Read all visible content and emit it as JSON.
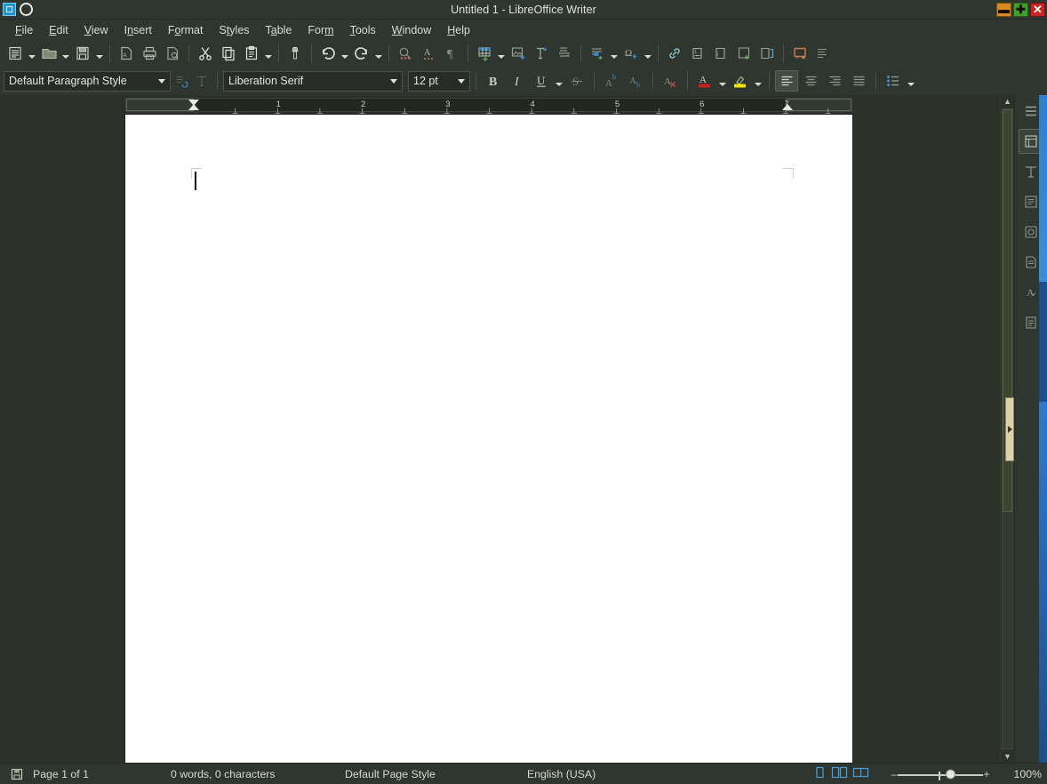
{
  "window": {
    "title": "Untitled 1 - LibreOffice Writer",
    "app_icon": "libreoffice-writer-icon",
    "controls": {
      "minimize": "–",
      "maximize": "＋",
      "close": "✕"
    }
  },
  "menubar": {
    "items": [
      {
        "label": "File",
        "pre": "F",
        "accel": "ile"
      },
      {
        "label": "Edit",
        "pre": "E",
        "accel": "dit"
      },
      {
        "label": "View",
        "pre": "V",
        "accel": "iew"
      },
      {
        "label": "Insert",
        "pre": "I",
        "accel": "nsert"
      },
      {
        "label": "Format",
        "pre": "F",
        "accel": "ormat"
      },
      {
        "label": "Styles",
        "pre": "S",
        "accel": "tyles"
      },
      {
        "label": "Table",
        "pre": "T",
        "accel": "able"
      },
      {
        "label": "Form",
        "pre": "Fo",
        "accel": "rm"
      },
      {
        "label": "Tools",
        "pre": "T",
        "accel": "ools"
      },
      {
        "label": "Window",
        "pre": "W",
        "accel": "indow"
      },
      {
        "label": "Help",
        "pre": "H",
        "accel": "elp"
      }
    ]
  },
  "standard_toolbar": {
    "buttons": [
      "new-document",
      "new-document-dropdown",
      "open-document",
      "open-document-dropdown",
      "save-document",
      "save-document-dropdown",
      "export-as-pdf",
      "print",
      "print-preview",
      "cut",
      "copy",
      "paste",
      "paste-dropdown",
      "clone-formatting",
      "undo",
      "undo-dropdown",
      "redo",
      "redo-dropdown",
      "find-and-replace",
      "spelling",
      "formatting-marks",
      "insert-table",
      "insert-table-dropdown",
      "insert-image",
      "insert-text-box",
      "insert-page-break",
      "insert-field",
      "insert-field-dropdown",
      "insert-special-character",
      "insert-special-character-dropdown",
      "insert-hyperlink",
      "insert-footnote",
      "insert-endnote",
      "insert-bookmark",
      "insert-cross-reference",
      "insert-comment",
      "track-changes"
    ]
  },
  "formatting_toolbar": {
    "paragraph_style": {
      "value": "Default Paragraph Style"
    },
    "font_name": {
      "value": "Liberation Serif"
    },
    "font_size": {
      "value": "12 pt"
    },
    "update_style": "update-selected-style",
    "new_style": "new-style-from-selection",
    "buttons": [
      "bold",
      "italic",
      "underline",
      "underline-dropdown",
      "strikethrough",
      "superscript",
      "subscript",
      "clear-direct-formatting",
      "font-color",
      "font-color-dropdown",
      "highlight-color",
      "highlight-color-dropdown",
      "align-left",
      "align-center",
      "align-right",
      "align-justified",
      "unordered-list",
      "unordered-list-dropdown"
    ],
    "font_color_swatch": "#cc2020",
    "highlight_color_swatch": "#f2e600",
    "active_button": "align-left"
  },
  "ruler": {
    "numbers": [
      "1",
      "2",
      "3",
      "4",
      "5",
      "6",
      "7"
    ],
    "tab_marker": "⊥",
    "unit": "inch"
  },
  "document": {
    "content": "",
    "cursor_visible": true
  },
  "sidebar": {
    "items": [
      {
        "name": "sidebar-settings",
        "label": "Sidebar Settings",
        "selected": false
      },
      {
        "name": "properties",
        "label": "Properties",
        "selected": true
      },
      {
        "name": "page",
        "label": "Page",
        "selected": false
      },
      {
        "name": "style-inspector",
        "label": "Style Inspector",
        "selected": false
      },
      {
        "name": "gallery",
        "label": "Gallery",
        "selected": false
      },
      {
        "name": "navigator",
        "label": "Navigator",
        "selected": false
      },
      {
        "name": "styles",
        "label": "Styles",
        "selected": false
      },
      {
        "name": "accessibility-check",
        "label": "Accessibility Check",
        "selected": false
      }
    ]
  },
  "statusbar": {
    "save_status_icon": "save-icon",
    "page_info": "Page 1 of 1",
    "word_count": "0 words, 0 characters",
    "page_style": "Default Page Style",
    "language": "English (USA)",
    "selection_mode": "",
    "view_single_page": "single-page-view-icon",
    "view_multi_page": "multi-page-view-icon",
    "view_book": "book-view-icon",
    "zoom_minus": "–",
    "zoom_plus": "+",
    "zoom_level": "100%"
  }
}
